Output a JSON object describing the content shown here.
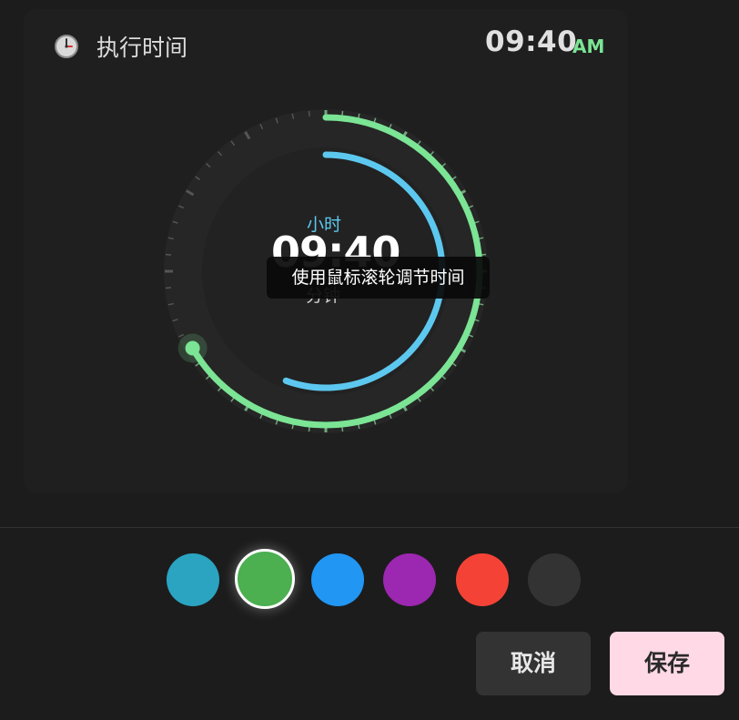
{
  "header": {
    "title": "执行时间",
    "time": "09:40",
    "period": "AM"
  },
  "dial": {
    "hour_label": "小时",
    "time": "09:40",
    "minute_label": "分钟",
    "hour": 9,
    "minute": 40
  },
  "tooltip": {
    "text": "使用鼠标滚轮调节时间"
  },
  "colors": {
    "accent_green": "#7be495",
    "accent_blue": "#5dc8ef",
    "save_bg": "#ffd9e5",
    "swatches": [
      "#2aa4c1",
      "#4caf50",
      "#2196f3",
      "#9c27b0",
      "#f44336",
      "#333333"
    ],
    "selected_swatch_index": 1
  },
  "buttons": {
    "cancel": "取消",
    "save": "保存"
  },
  "icons": {
    "header": "clock-icon"
  }
}
